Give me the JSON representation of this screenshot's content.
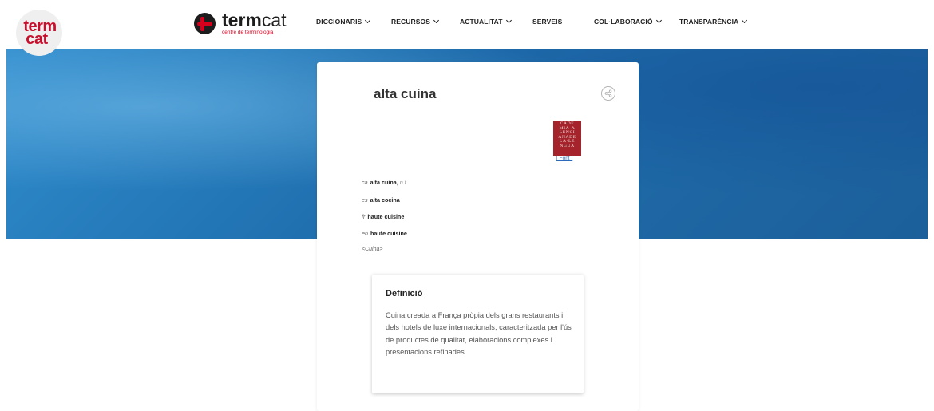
{
  "corner_logo": {
    "line1": "term",
    "line2": "cat"
  },
  "brand": {
    "name_bold": "term",
    "name_rest": "cat",
    "tagline": "centre de terminologia"
  },
  "nav": {
    "items": [
      {
        "label": "DICCIONARIS",
        "dropdown": true
      },
      {
        "label": "RECURSOS",
        "dropdown": true
      },
      {
        "label": "ACTUALITAT",
        "dropdown": true
      },
      {
        "label": "SERVEIS",
        "dropdown": false
      },
      {
        "label": "COL·LABORACIÓ",
        "dropdown": true
      },
      {
        "label": "TRANSPARÈNCIA",
        "dropdown": true
      }
    ]
  },
  "entry": {
    "title": "alta cuina",
    "share_icon": "share-icon",
    "source_logo_text": [
      "CADE",
      "MIA·A",
      "LENCI",
      "ANADE",
      "LA·LE",
      "NGUA"
    ],
    "source_link": "[ Font ]",
    "terms": [
      {
        "lang": "ca",
        "term": "alta cuina,",
        "gram": "n f"
      },
      {
        "lang": "es",
        "term": "alta cocina",
        "gram": ""
      },
      {
        "lang": "fr",
        "term": "haute cuisine",
        "gram": ""
      },
      {
        "lang": "en",
        "term": "haute cuisine",
        "gram": ""
      }
    ],
    "area": "<Cuina>",
    "definition": {
      "heading": "Definició",
      "text": "Cuina creada a França pròpia dels grans restaurants i dels hotels de luxe internacionals, caracteritzada per l'ús de productes de qualitat, elaboracions complexes i presentacions refinades."
    }
  },
  "colors": {
    "brand_red": "#d6001c",
    "hero_blue": "#1f6fae"
  }
}
